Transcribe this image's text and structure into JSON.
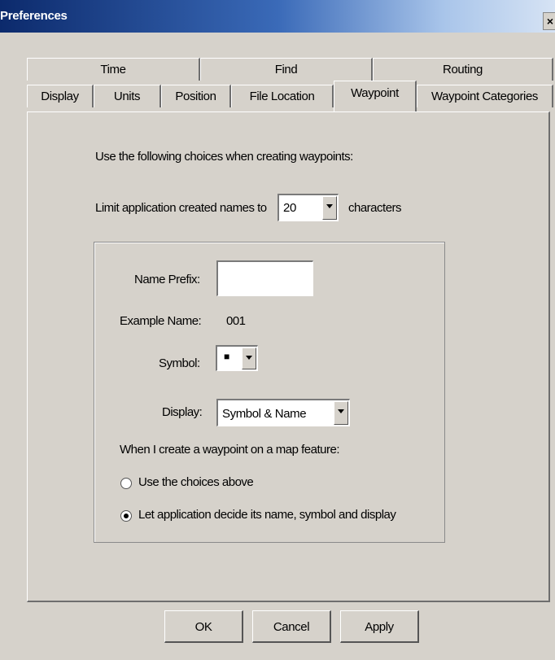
{
  "window": {
    "title": "Preferences",
    "close_glyph": "×"
  },
  "tabs_row1": [
    "Time",
    "Find",
    "Routing"
  ],
  "tabs_row2": [
    "Display",
    "Units",
    "Position",
    "File Location",
    "Waypoint",
    "Waypoint Categories"
  ],
  "active_tab": "Waypoint",
  "waypoint": {
    "intro": "Use the following choices when creating waypoints:",
    "limit_label": "Limit application created names to",
    "limit_value": "20",
    "limit_suffix": "characters",
    "name_prefix_label": "Name Prefix:",
    "name_prefix_value": "",
    "example_label": "Example Name:",
    "example_value": "001",
    "symbol_label": "Symbol:",
    "symbol_value": "■",
    "display_label": "Display:",
    "display_value": "Symbol & Name",
    "map_feature_label": "When I create a waypoint on a map feature:",
    "radio_options": [
      {
        "label": "Use the choices above",
        "checked": false
      },
      {
        "label": "Let application decide its name, symbol and display",
        "checked": true
      }
    ]
  },
  "buttons": {
    "ok": "OK",
    "cancel": "Cancel",
    "apply": "Apply"
  }
}
